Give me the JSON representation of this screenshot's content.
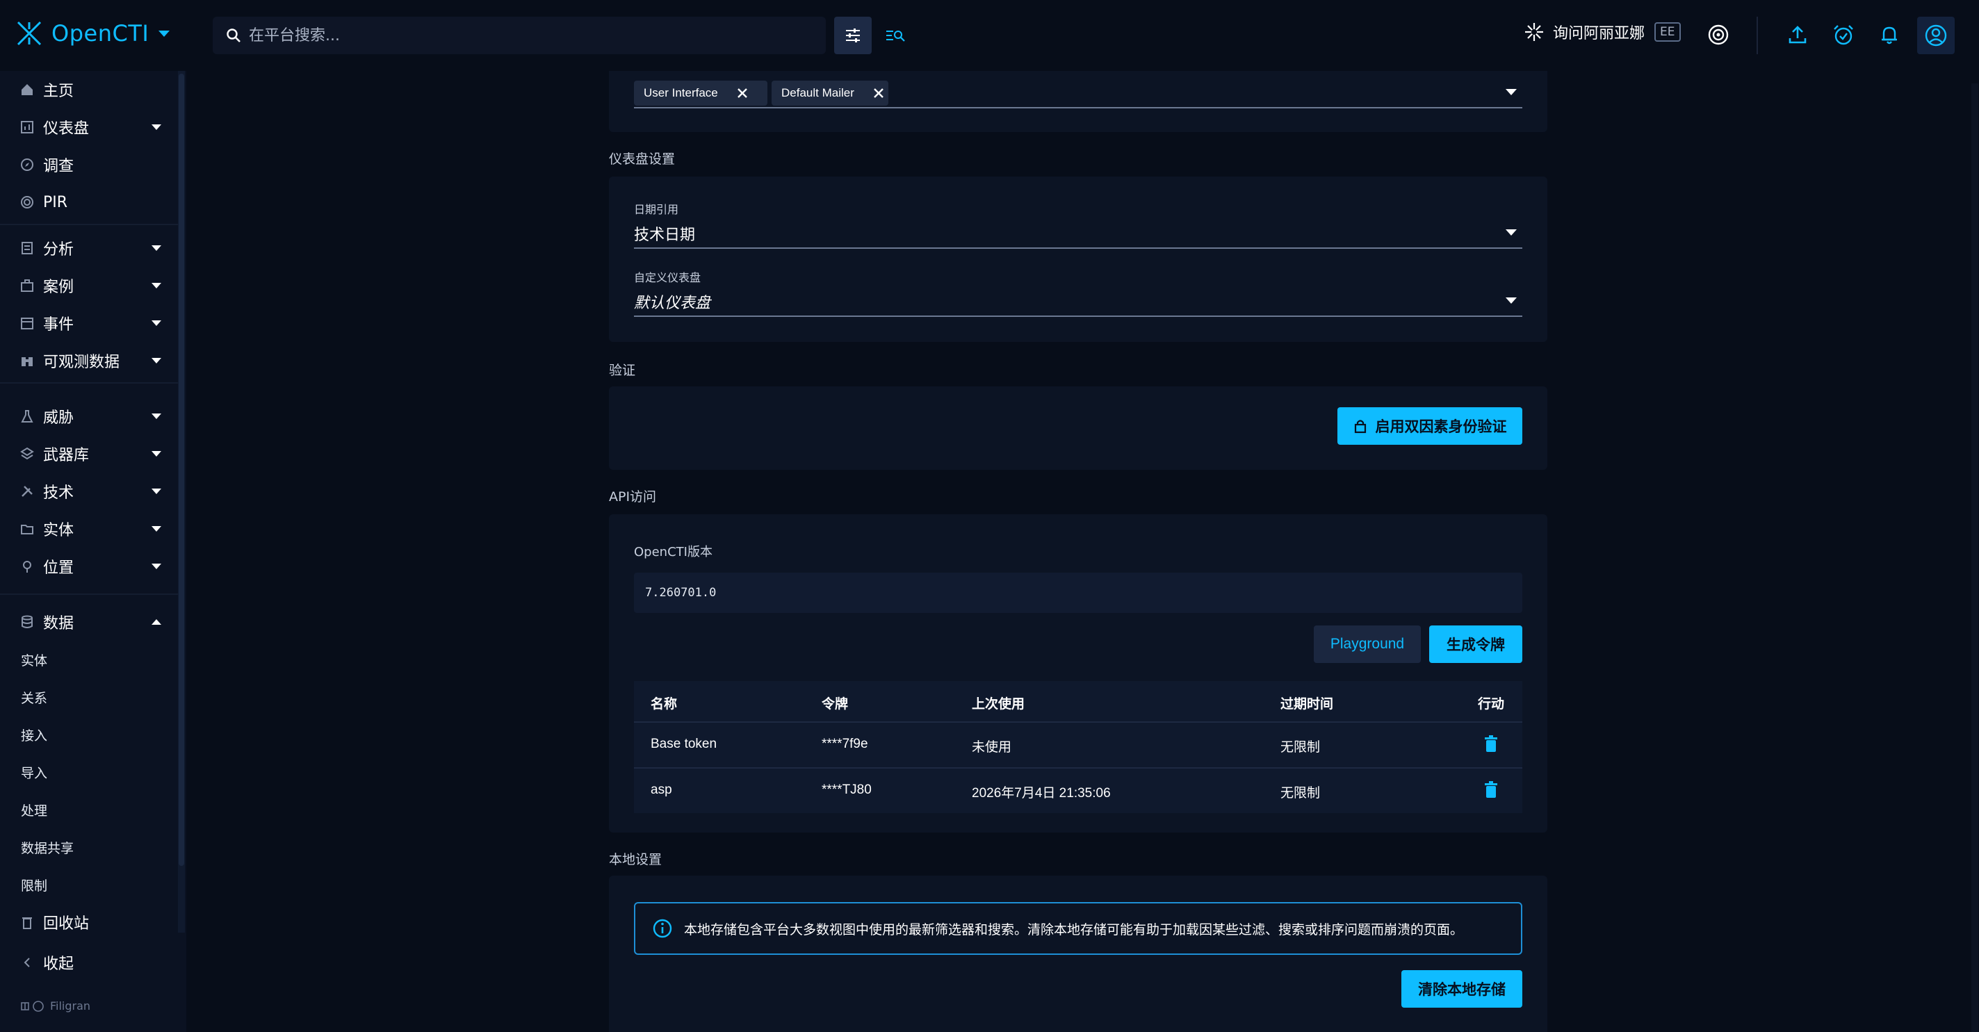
{
  "app": {
    "name": "OpenCTI",
    "brand_color": "#0fbcff"
  },
  "search": {
    "placeholder": "在平台搜索..."
  },
  "header": {
    "ask_ai_label": "询问阿丽亚娜",
    "ee_badge": "EE"
  },
  "sidebar": {
    "items": [
      {
        "label": "主页",
        "icon": "home-icon",
        "has_caret": false
      },
      {
        "label": "仪表盘",
        "icon": "dashboard-icon",
        "has_caret": true
      },
      {
        "label": "调查",
        "icon": "explore-icon",
        "has_caret": false
      },
      {
        "label": "PIR",
        "icon": "radar-icon",
        "has_caret": false
      },
      {
        "label": "分析",
        "icon": "analysis-icon",
        "has_caret": true
      },
      {
        "label": "案例",
        "icon": "cases-icon",
        "has_caret": true
      },
      {
        "label": "事件",
        "icon": "events-icon",
        "has_caret": true
      },
      {
        "label": "可观测数据",
        "icon": "binoculars-icon",
        "has_caret": true
      },
      {
        "label": "威胁",
        "icon": "threats-icon",
        "has_caret": true
      },
      {
        "label": "武器库",
        "icon": "arsenal-icon",
        "has_caret": true
      },
      {
        "label": "技术",
        "icon": "techniques-icon",
        "has_caret": true
      },
      {
        "label": "实体",
        "icon": "entities-icon",
        "has_caret": true
      },
      {
        "label": "位置",
        "icon": "location-icon",
        "has_caret": true
      },
      {
        "label": "数据",
        "icon": "database-icon",
        "has_caret": true
      }
    ],
    "data_subitems": [
      "实体",
      "关系",
      "接入",
      "导入",
      "处理",
      "数据共享",
      "限制"
    ],
    "trash_label": "回收站",
    "collapse_label": "收起",
    "footer": "Filigran"
  },
  "notifiers": {
    "chips": [
      "User Interface",
      "Default Mailer"
    ]
  },
  "dashboard_settings": {
    "title": "仪表盘设置",
    "date_ref_label": "日期引用",
    "date_ref_value": "技术日期",
    "custom_dashboard_label": "自定义仪表盘",
    "custom_dashboard_value": "默认仪表盘"
  },
  "auth": {
    "title": "验证",
    "enable_2fa_label": "启用双因素身份验证"
  },
  "api": {
    "title": "API访问",
    "version_label": "OpenCTI版本",
    "version_value": "7.260701.0",
    "playground_label": "Playground",
    "generate_token_label": "生成令牌",
    "columns": [
      "名称",
      "令牌",
      "上次使用",
      "过期时间",
      "行动"
    ],
    "tokens": [
      {
        "name": "Base token",
        "token": "****7f9e",
        "last_used": "未使用",
        "expires": "无限制"
      },
      {
        "name": "asp",
        "token": "****TJ80",
        "last_used": "2026年7月4日 21:35:06",
        "expires": "无限制"
      }
    ]
  },
  "local_settings": {
    "title": "本地设置",
    "info": "本地存储包含平台大多数视图中使用的最新筛选器和搜索。清除本地存储可能有助于加载因某些过滤、搜索或排序问题而崩溃的页面。",
    "clear_label": "清除本地存储"
  }
}
